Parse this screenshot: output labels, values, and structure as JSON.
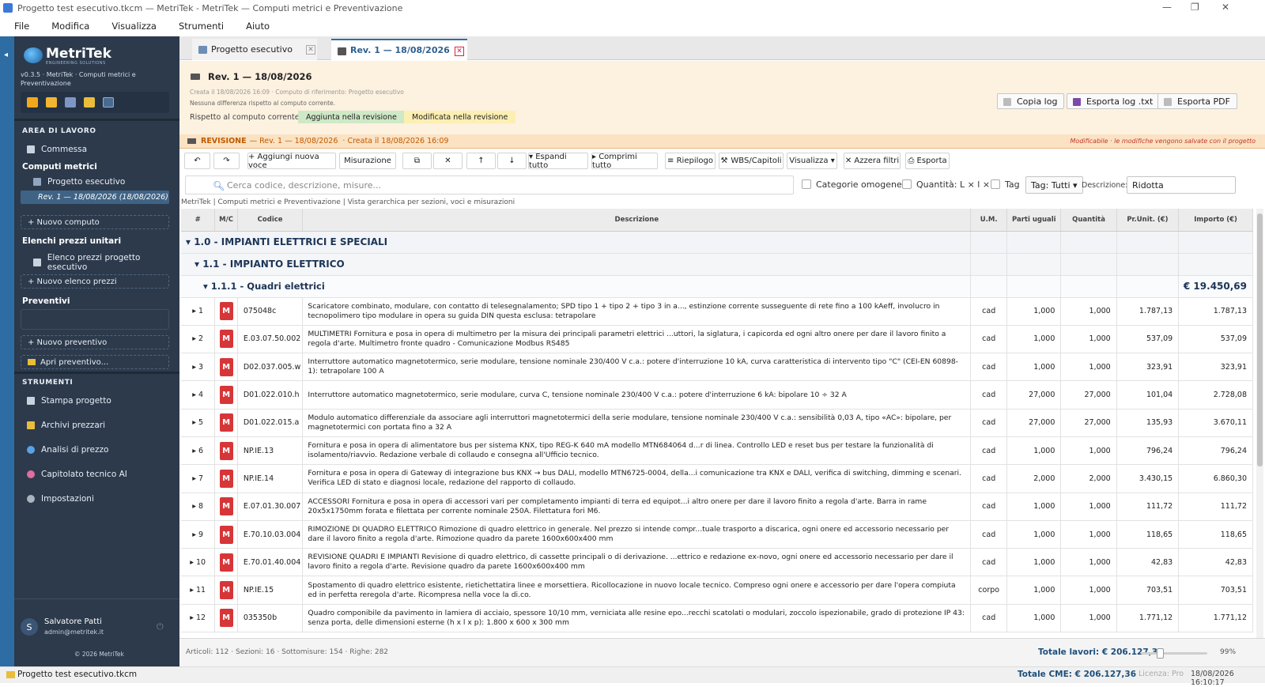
{
  "window": {
    "title": "Progetto test esecutivo.tkcm — MetriTek - MetriTek — Computi metrici e Preventivazione"
  },
  "menu": [
    "File",
    "Modifica",
    "Visualizza",
    "Strumenti",
    "Aiuto"
  ],
  "sidebar": {
    "logo_name": "MetriTek",
    "logo_sub": "ENGINEERING SOLUTIONS",
    "version": "v0.3.5  ·  MetriTek  ·  Computi metrici e Preventivazione",
    "area_heading": "AREA DI LAVORO",
    "commessa": "Commessa",
    "computi_heading": "Computi metrici",
    "progetto_esecutivo": "Progetto esecutivo",
    "rev_item": "Rev. 1 — 18/08/2026  (18/08/2026)",
    "nuovo_computo": "+   Nuovo computo",
    "elenchi_heading": "Elenchi prezzi unitari",
    "elenco_item": "Elenco prezzi progetto esecutivo",
    "nuovo_elenco": "+   Nuovo elenco prezzi",
    "preventivi_heading": "Preventivi",
    "nuovo_preventivo": "+   Nuovo preventivo",
    "apri_preventivo": "Apri preventivo...",
    "strumenti_heading": "STRUMENTI",
    "tools": [
      "Stampa progetto",
      "Archivi prezzari",
      "Analisi di prezzo",
      "Capitolato tecnico AI",
      "Impostazioni"
    ],
    "user_initial": "S",
    "user_name": "Salvatore Patti",
    "user_email": "admin@metritek.it",
    "copyright": "© 2026 MetriTek"
  },
  "tabs": [
    {
      "label": "Progetto esecutivo"
    },
    {
      "label": "Rev. 1 — 18/08/2026"
    }
  ],
  "revision": {
    "title": "Rev. 1 — 18/08/2026",
    "meta1": "Creata il 18/08/2026  16:09   ·   Computo di riferimento: Progetto esecutivo",
    "meta2": "Nessuna differenza rispetto al computo corrente.",
    "compare_label": "Rispetto al computo corrente:",
    "badge_added": "Aggiunta nella revisione",
    "badge_modified": "Modificata nella revisione",
    "copy_log": "Copia log",
    "export_log": "Esporta log .txt",
    "export_pdf": "Esporta PDF",
    "bar_label": "REVISIONE",
    "bar_rev": "— Rev. 1 — 18/08/2026",
    "bar_created": "·  Creata il 18/08/2026 16:09",
    "bar_note": "Modificabile · le modifiche vengono salvate con il progetto"
  },
  "toolbar": {
    "undo": "↶",
    "redo": "↷",
    "add_item": "+  Aggiungi nuova voce",
    "measure": "Misurazione",
    "copy": "⧉",
    "delete": "✕",
    "up": "↑",
    "down": "↓",
    "expand": "▾ Espandi tutto",
    "collapse": "▸ Comprimi tutto",
    "summary": "≡ Riepilogo",
    "wbs": "WBS/Capitoli",
    "view": "Visualizza ▾",
    "reset": "✕ Azzera filtri",
    "export": "⎙ Esporta"
  },
  "search": {
    "placeholder": "Cerca codice, descrizione, misure...",
    "cat_label": "Categorie omogenee",
    "qty_label": "Quantità: L × l × h",
    "tag_label": "Tag",
    "tag_select": "Tag: Tutti ▾",
    "desc_label": "Descrizione:",
    "desc_select": "Ridotta"
  },
  "breadcrumb": "MetriTek | Computi metrici e Preventivazione | Vista gerarchica per sezioni, voci e misurazioni",
  "table": {
    "headers": [
      "#",
      "M/C",
      "Codice",
      "Descrizione",
      "U.M.",
      "Parti uguali",
      "Quantità",
      "Pr.Unit. (€)",
      "Importo (€)"
    ],
    "section1": "▾ 1.0 - IMPIANTI ELETTRICI E SPECIALI",
    "section2": "▾ 1.1 - IMPIANTO ELETTRICO",
    "section3": "▾ 1.1.1 - Quadri elettrici",
    "section3_total": "€ 19.450,69",
    "rows": [
      {
        "n": "▸ 1",
        "m": "M",
        "code": "075048c",
        "desc": "Scaricatore combinato, modulare, con contatto di telesegnalamento; SPD tipo 1 + tipo 2 + tipo 3 in a..., estinzione corrente susseguente di rete fino a 100 kAeff, involucro in tecnopolimero tipo modulare in opera su guida DIN questa esclusa: tetrapolare",
        "um": "cad",
        "parti": "1,000",
        "qty": "1,000",
        "pu": "1.787,13",
        "imp": "1.787,13"
      },
      {
        "n": "▸ 2",
        "m": "M",
        "code": "E.03.07.50.002",
        "desc": "MULTIMETRI Fornitura e posa in opera di multimetro per la misura dei principali parametri elettrici ...uttori, la siglatura, i capicorda ed ogni altro onere per dare il lavoro finito a regola d'arte. Multimetro fronte quadro - Comunicazione Modbus RS485",
        "um": "cad",
        "parti": "1,000",
        "qty": "1,000",
        "pu": "537,09",
        "imp": "537,09"
      },
      {
        "n": "▸ 3",
        "m": "M",
        "code": "D02.037.005.w",
        "desc": "Interruttore automatico magnetotermico, serie modulare, tensione nominale 230/400 V c.a.: potere d'interruzione 10 kA, curva caratteristica di intervento tipo \"C\" (CEI-EN 60898-1): tetrapolare 100 A",
        "um": "cad",
        "parti": "1,000",
        "qty": "1,000",
        "pu": "323,91",
        "imp": "323,91"
      },
      {
        "n": "▸ 4",
        "m": "M",
        "code": "D01.022.010.h",
        "desc": "Interruttore automatico magnetotermico, serie modulare, curva C, tensione nominale 230/400 V c.a.: potere d'interruzione 6 kA: bipolare 10 ÷ 32 A",
        "um": "cad",
        "parti": "27,000",
        "qty": "27,000",
        "pu": "101,04",
        "imp": "2.728,08"
      },
      {
        "n": "▸ 5",
        "m": "M",
        "code": "D01.022.015.a",
        "desc": "Modulo automatico differenziale da associare agli interruttori magnetotermici della serie modulare, tensione nominale 230/400 V c.a.: sensibilità 0,03 A, tipo «AC»: bipolare, per magnetotermici con portata fino a 32 A",
        "um": "cad",
        "parti": "27,000",
        "qty": "27,000",
        "pu": "135,93",
        "imp": "3.670,11"
      },
      {
        "n": "▸ 6",
        "m": "M",
        "code": "NP.IE.13",
        "desc": "Fornitura e posa in opera di alimentatore bus per sistema KNX, tipo REG-K 640 mA modello MTN684064 d...r di linea. Controllo LED e reset bus per testare la funzionalità di isolamento/riavvio. Redazione verbale di collaudo e consegna all'Ufficio tecnico.",
        "um": "cad",
        "parti": "1,000",
        "qty": "1,000",
        "pu": "796,24",
        "imp": "796,24"
      },
      {
        "n": "▸ 7",
        "m": "M",
        "code": "NP.IE.14",
        "desc": "Fornitura e posa in opera di Gateway di integrazione bus KNX → bus DALI, modello MTN6725-0004, della...i comunicazione tra KNX e DALI, verifica di switching, dimming e scenari. Verifica LED di stato e diagnosi locale, redazione del rapporto di collaudo.",
        "um": "cad",
        "parti": "2,000",
        "qty": "2,000",
        "pu": "3.430,15",
        "imp": "6.860,30"
      },
      {
        "n": "▸ 8",
        "m": "M",
        "code": "E.07.01.30.007",
        "desc": "ACCESSORI Fornitura e posa in opera di accessori vari per completamento impianti di terra ed equipot...i altro onere per dare il lavoro finito a regola d'arte. Barra in rame 20x5x1750mm forata e filettata per corrente nominale 250A. Filettatura fori M6.",
        "um": "cad",
        "parti": "1,000",
        "qty": "1,000",
        "pu": "111,72",
        "imp": "111,72"
      },
      {
        "n": "▸ 9",
        "m": "M",
        "code": "E.70.10.03.004",
        "desc": "RIMOZIONE DI QUADRO ELETTRICO Rimozione di quadro elettrico in generale. Nel prezzo si intende compr...tuale trasporto a discarica, ogni onere ed accessorio necessario per dare il lavoro finito a regola d'arte. Rimozione quadro da parete 1600x600x400 mm",
        "um": "cad",
        "parti": "1,000",
        "qty": "1,000",
        "pu": "118,65",
        "imp": "118,65"
      },
      {
        "n": "▸ 10",
        "m": "M",
        "code": "E.70.01.40.004",
        "desc": "REVISIONE QUADRI E IMPIANTI Revisione di quadro elettrico, di cassette principali o di derivazione. ...ettrico e redazione ex-novo, ogni onere ed accessorio necessario per dare il lavoro finito a regola d'arte. Revisione quadro da parete 1600x600x400 mm",
        "um": "cad",
        "parti": "1,000",
        "qty": "1,000",
        "pu": "42,83",
        "imp": "42,83"
      },
      {
        "n": "▸ 11",
        "m": "M",
        "code": "NP.IE.15",
        "desc": "Spostamento di quadro elettrico esistente, rietichettatira linee e morsettiera. Ricollocazione in nuovo locale tecnico. Compreso ogni onere e accessorio per dare l'opera compiuta ed in perfetta reregola d'arte. Ricompresa nella voce la di.co.",
        "um": "corpo",
        "parti": "1,000",
        "qty": "1,000",
        "pu": "703,51",
        "imp": "703,51"
      },
      {
        "n": "▸ 12",
        "m": "M",
        "code": "035350b",
        "desc": "Quadro componibile da pavimento in lamiera di acciaio, spessore 10/10 mm, verniciata alle resine epo...recchi scatolati o modulari, zoccolo ispezionabile, grado di protezione IP 43: senza porta, delle dimensioni esterne (h x l x p): 1.800 x 600 x 300 mm",
        "um": "cad",
        "parti": "1,000",
        "qty": "1,000",
        "pu": "1.771,12",
        "imp": "1.771,12"
      }
    ]
  },
  "footer": {
    "stats": "Articoli: 112   ·   Sezioni: 16   ·   Sottomisure: 154   ·   Righe: 282",
    "total": "Totale lavori: € 206.127,36",
    "zoom": "99%"
  },
  "status": {
    "file": "Progetto test esecutivo.tkcm",
    "total_cme": "Totale CME: € 206.127,36",
    "license": "Licenza: Pro",
    "datetime": "18/08/2026  16:10:17"
  },
  "colors": {
    "sidebar": "#2c3a4c",
    "accent": "#2e6da4",
    "m_badge": "#d63638",
    "revision_bg": "#fdf1e0"
  }
}
